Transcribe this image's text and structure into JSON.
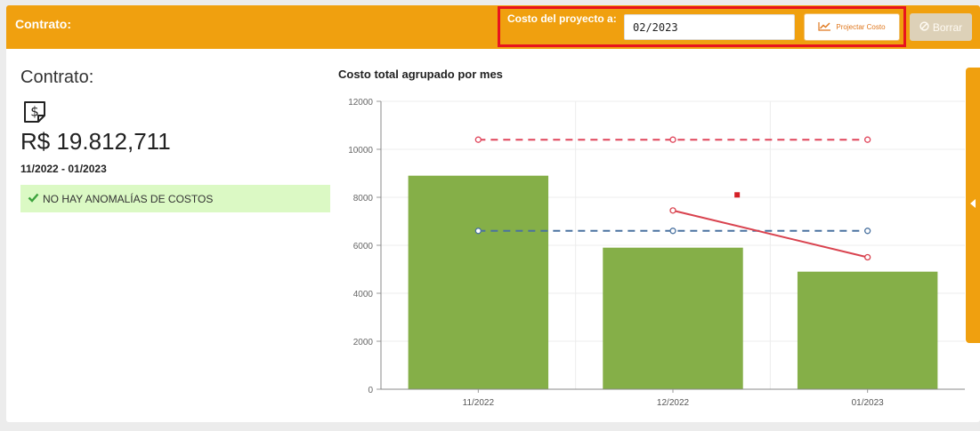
{
  "header": {
    "title": "Contrato:",
    "projection_label": "Costo del proyecto a:",
    "projection_value": "02/2023",
    "project_button": "Projectar Costo",
    "delete_button": "Borrar"
  },
  "summary": {
    "title": "Contrato:",
    "amount": "R$ 19.812,711",
    "date_range": "11/2022 - 01/2023",
    "alert": "NO HAY ANOMALÍAS DE COSTOS"
  },
  "colors": {
    "header": "#f0a00f",
    "highlight": "#e8141e",
    "bar": "#85af48",
    "upper_line": "#e0445a",
    "mean_line": "#4a72a0",
    "trend_line": "#d9434f",
    "alert_bg": "#dbf9c4"
  },
  "icons": {
    "projection": "line-chart-icon",
    "delete": "ban-icon",
    "document": "dollar-document-icon",
    "check": "check-icon"
  },
  "chart_data": {
    "type": "bar",
    "title": "Costo total agrupado por mes",
    "categories": [
      "11/2022",
      "12/2022",
      "01/2023"
    ],
    "values": [
      8900,
      5900,
      4900
    ],
    "ylim": [
      0,
      12000
    ],
    "yticks": [
      0,
      2000,
      4000,
      6000,
      8000,
      10000,
      12000
    ],
    "grid": true,
    "overlays": [
      {
        "kind": "dashed",
        "color": "#e0445a",
        "values": [
          10400,
          10400,
          10400
        ]
      },
      {
        "kind": "dashed",
        "color": "#4a72a0",
        "values": [
          6600,
          6600,
          6600
        ]
      },
      {
        "kind": "solid",
        "color": "#d9434f",
        "x_start": 1,
        "values": [
          7450,
          5500
        ]
      }
    ],
    "marker": {
      "x": 1.83,
      "y": 8100,
      "color": "#d41f26"
    }
  }
}
